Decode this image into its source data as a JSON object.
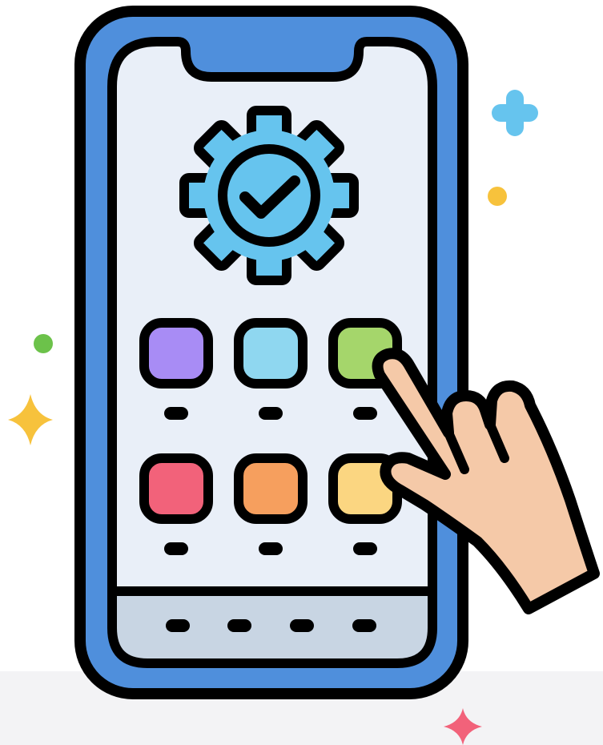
{
  "colors": {
    "background": "#ffffff",
    "bottom_band": "#f3f3f5",
    "outline": "#000000",
    "phone_frame": "#4f8fdc",
    "screen": "#e9eff8",
    "dock": "#c8d5e3",
    "gear": "#66c4ee",
    "app_purple": "#a88cf5",
    "app_light_blue": "#8fd7f0",
    "app_green": "#a5d66b",
    "app_red": "#f2627a",
    "app_orange": "#f69f5e",
    "app_yellow": "#fbd681",
    "hand_skin": "#f5c9a8",
    "sparkle_blue": "#66c4ee",
    "sparkle_yellow": "#f7c23c",
    "sparkle_green": "#6cc24a",
    "sparkle_pink": "#f2627a"
  },
  "icons": {
    "phone": "smartphone-icon",
    "gear": "gear-check-icon",
    "hand": "pointing-hand-icon",
    "apps": [
      "app-icon-purple",
      "app-icon-light-blue",
      "app-icon-green",
      "app-icon-red",
      "app-icon-orange",
      "app-icon-yellow"
    ]
  }
}
